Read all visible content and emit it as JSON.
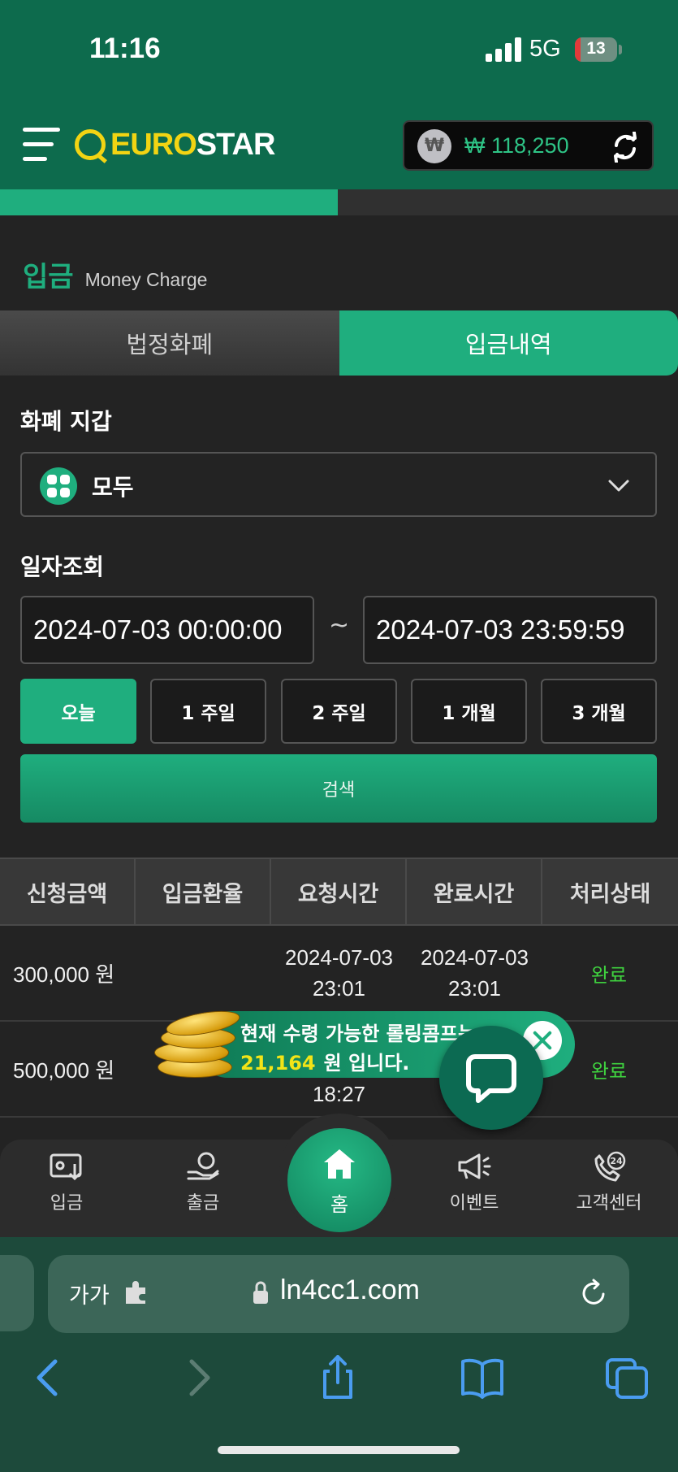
{
  "status_bar": {
    "time": "11:16",
    "network": "5G",
    "battery": "13",
    "battery_level_percent": 13
  },
  "header": {
    "logo_part1": "EURO",
    "logo_part2": "STAR",
    "balance": "₩ 118,250",
    "currency_symbol": "₩"
  },
  "section": {
    "title_ko": "입금",
    "title_en": "Money Charge"
  },
  "tabs": [
    {
      "label": "법정화폐",
      "active": false
    },
    {
      "label": "입금내역",
      "active": true
    }
  ],
  "wallet": {
    "label": "화폐 지갑",
    "selected": "모두"
  },
  "date_query": {
    "label": "일자조회",
    "start": "2024-07-03 00:00:00",
    "end": "2024-07-03 23:59:59",
    "separator": "~"
  },
  "ranges": [
    {
      "label": "오늘",
      "active": true
    },
    {
      "label": "1 주일",
      "active": false
    },
    {
      "label": "2 주일",
      "active": false
    },
    {
      "label": "1 개월",
      "active": false
    },
    {
      "label": "3 개월",
      "active": false
    }
  ],
  "search_label": "검색",
  "table": {
    "headers": [
      "신청금액",
      "입금환율",
      "요청시간",
      "완료시간",
      "처리상태"
    ],
    "rows": [
      {
        "amount": "300,000 원",
        "rate": "",
        "requested_date": "2024-07-03",
        "requested_time": "23:01",
        "completed_date": "2024-07-03",
        "completed_time": "23:01",
        "status": "완료"
      },
      {
        "amount": "500,000 원",
        "rate": "",
        "requested_date": "",
        "requested_time": "18:27",
        "completed_date": "",
        "completed_time": "",
        "status": "완료"
      }
    ]
  },
  "promo": {
    "line1": "현재 수령 가능한 롤링콤프는",
    "amount": "21,164",
    "suffix": "원 입니다."
  },
  "bottom_nav": [
    {
      "label": "입금",
      "icon": "deposit-icon"
    },
    {
      "label": "출금",
      "icon": "withdraw-icon"
    },
    {
      "label": "홈",
      "icon": "home-icon"
    },
    {
      "label": "이벤트",
      "icon": "megaphone-icon"
    },
    {
      "label": "고객센터",
      "icon": "support-24-icon"
    }
  ],
  "browser": {
    "aa": "가가",
    "url": "ln4cc1.com"
  },
  "colors": {
    "header_green": "#0d6b4d",
    "accent_green": "#1fae7e",
    "logo_yellow": "#f2d413",
    "status_done": "#3fd13f",
    "highlight_yellow": "#f2e417"
  }
}
